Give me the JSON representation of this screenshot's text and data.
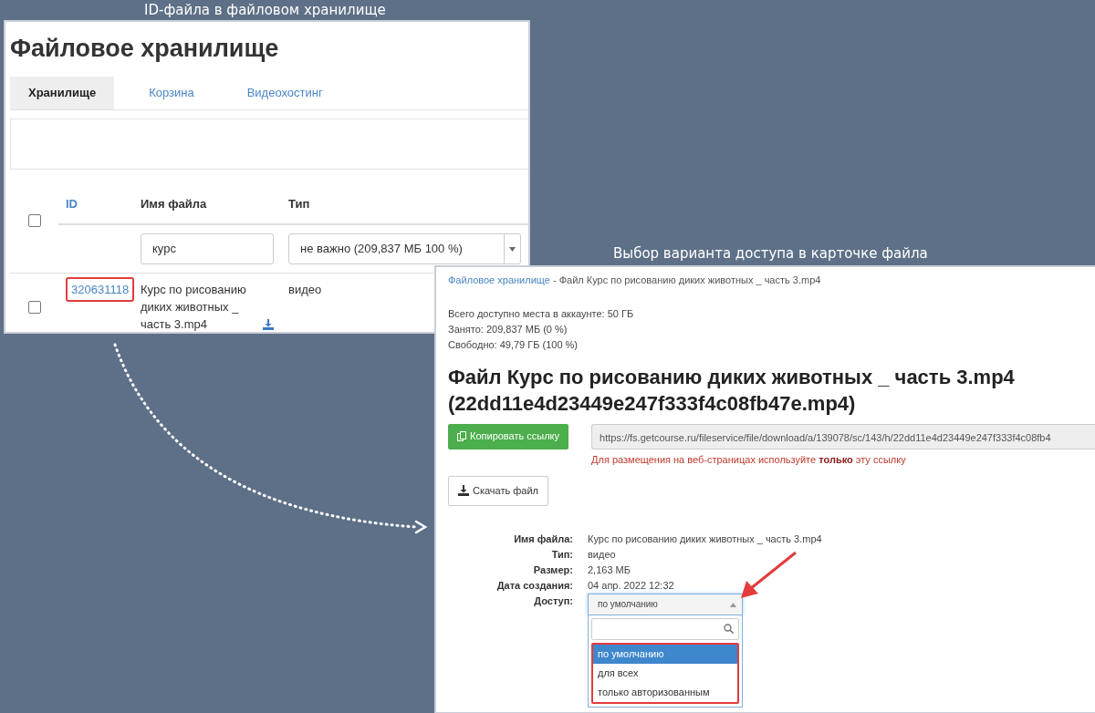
{
  "storage_panel": {
    "caption": "ID-файла в файловом хранилище",
    "title": "Файловое хранилище",
    "tabs": [
      {
        "label": "Хранилище",
        "selected": true
      },
      {
        "label": "Корзина",
        "selected": false
      },
      {
        "label": "Видеохостинг",
        "selected": false
      }
    ],
    "table": {
      "select_all_checked": false,
      "columns": [
        "ID",
        "Имя файла",
        "Тип"
      ],
      "filters": {
        "name": "курс",
        "type": "не важно (209,837 МБ 100 %)"
      },
      "rows": [
        {
          "checked": false,
          "id": "320631118",
          "id_highlighted": true,
          "name": "Курс по рисованию диких животных _ часть 3.mp4",
          "type": "видео"
        }
      ]
    }
  },
  "file_card": {
    "caption": "Выбор варианта доступа в карточке файла",
    "breadcrumb": {
      "link": "Файловое хранилище",
      "separator": "-",
      "current": "Файл Курс по рисованию диких животных _ часть 3.mp4"
    },
    "quota": [
      "Всего доступно места в аккаунте: 50 ГБ",
      "Занято: 209,837 МБ (0 %)",
      "Свободно: 49,79 ГБ (100 %)"
    ],
    "title": "Файл Курс по рисованию диких животных _ часть 3.mp4 (22dd11e4d23449e247f333f4c08fb47e.mp4)",
    "copy_button": "Копировать ссылку",
    "link_value": "https://fs.getcourse.ru/fileservice/file/download/a/139078/sc/143/h/22dd11e4d23449e247f333f4c08fb4",
    "link_hint": "Для размещения на веб-страницах используйте **только** эту ссылку",
    "download_button": "Скачать файл",
    "details": [
      {
        "label": "Имя файла:",
        "value": "Курс по рисованию диких животных _ часть 3.mp4"
      },
      {
        "label": "Тип:",
        "value": "видео"
      },
      {
        "label": "Размер:",
        "value": "2,163 МБ"
      },
      {
        "label": "Дата создания:",
        "value": "04 апр. 2022 12:32"
      }
    ],
    "access": {
      "label": "Доступ:",
      "value": "по умолчанию",
      "expanded": true,
      "options_highlighted": true,
      "options": [
        {
          "label": "по умолчанию",
          "selected": true
        },
        {
          "label": "для всех",
          "selected": false
        },
        {
          "label": "только авторизованным",
          "selected": false
        }
      ]
    }
  }
}
